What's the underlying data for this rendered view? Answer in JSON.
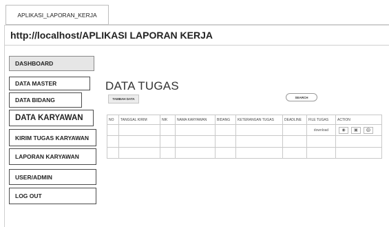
{
  "app": {
    "tab_title": "APLIKASI_LAPORAN_KERJA",
    "url": "http://localhost/APLIKASI LAPORAN KERJA"
  },
  "nav": {
    "items": [
      {
        "label": "DASHBOARD"
      },
      {
        "label": "DATA MASTER"
      },
      {
        "label": "DATA BIDANG"
      },
      {
        "label": "DATA KARYAWAN"
      },
      {
        "label": "KIRIM TUGAS KARYAWAN"
      },
      {
        "label": "LAPORAN KARYAWAN"
      },
      {
        "label": "USER/ADMIN"
      },
      {
        "label": "LOG OUT"
      }
    ]
  },
  "main": {
    "title": "DATA TUGAS",
    "add_button": "TAMBAH DATA",
    "search_button": "SEARCH",
    "table": {
      "headers": [
        "NO",
        "TANGGAL KIRIM",
        "NIK",
        "NAMA KARYAWAN",
        "BIDANG",
        "KETERANGAN TUGAS",
        "DEADLINE",
        "FILE TUGAS",
        "ACTION"
      ],
      "row1": {
        "file": "download"
      },
      "action_icons": [
        "view-icon",
        "edit-icon",
        "delete-icon"
      ]
    }
  }
}
